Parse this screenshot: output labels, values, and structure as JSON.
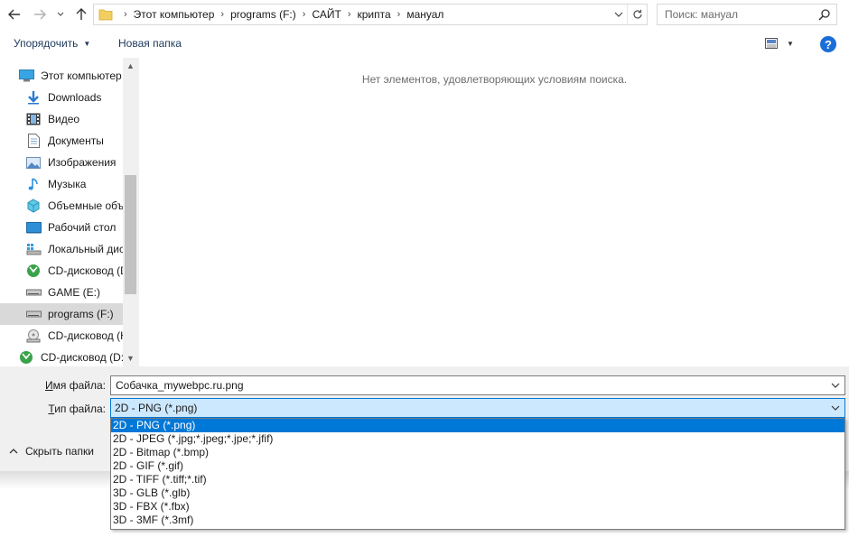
{
  "address_bar": {
    "breadcrumbs": [
      "Этот компьютер",
      "programs (F:)",
      "САЙТ",
      "крипта",
      "мануал"
    ],
    "search_placeholder": "Поиск: мануал"
  },
  "toolbar": {
    "organize_label": "Упорядочить",
    "new_folder_label": "Новая папка",
    "help_label": "?"
  },
  "nav_pane": {
    "items": [
      {
        "label": "Этот компьютер",
        "icon": "computer-icon",
        "indent": 0
      },
      {
        "label": "Downloads",
        "icon": "downloads-icon",
        "indent": 1
      },
      {
        "label": "Видео",
        "icon": "video-icon",
        "indent": 1
      },
      {
        "label": "Документы",
        "icon": "documents-icon",
        "indent": 1
      },
      {
        "label": "Изображения",
        "icon": "pictures-icon",
        "indent": 1
      },
      {
        "label": "Музыка",
        "icon": "music-icon",
        "indent": 1
      },
      {
        "label": "Объемные объ",
        "icon": "3d-objects-icon",
        "indent": 1
      },
      {
        "label": "Рабочий стол",
        "icon": "desktop-icon",
        "indent": 1
      },
      {
        "label": "Локальный дис",
        "icon": "local-disk-icon",
        "indent": 1
      },
      {
        "label": "CD-дисковод (D",
        "icon": "cd-drive-icon",
        "indent": 1
      },
      {
        "label": "GAME (E:)",
        "icon": "drive-icon",
        "indent": 1
      },
      {
        "label": "programs (F:)",
        "icon": "drive-icon",
        "indent": 1,
        "selected": true
      },
      {
        "label": "CD-дисковод (H",
        "icon": "cd-drive-icon",
        "indent": 1
      },
      {
        "label": "CD-дисковод (D:)",
        "icon": "cd-drive-icon",
        "indent": 0
      }
    ]
  },
  "content": {
    "empty_message": "Нет элементов, удовлетворяющих условиям поиска."
  },
  "bottom": {
    "filename_label": "Имя файла:",
    "filename_accel": "И",
    "filename_rest": "мя файла:",
    "filename_value": "Собачка_mywebpc.ru.png",
    "filetype_label": "Тип файла:",
    "filetype_accel": "Т",
    "filetype_rest": "ип файла:",
    "filetype_value": "2D - PNG (*.png)",
    "hide_folders_label": "Скрыть папки"
  },
  "dropdown": {
    "selected_index": 0,
    "options": [
      "2D - PNG (*.png)",
      "2D - JPEG (*.jpg;*.jpeg;*.jpe;*.jfif)",
      "2D - Bitmap (*.bmp)",
      "2D - GIF (*.gif)",
      "2D - TIFF (*.tiff;*.tif)",
      "3D - GLB (*.glb)",
      "3D - FBX (*.fbx)",
      "3D - 3MF (*.3mf)"
    ]
  },
  "colors": {
    "accent": "#0078d7",
    "selection_bg": "#cce8ff",
    "nav_selected": "#d9d9d9",
    "panel_bg": "#f0f0f0"
  }
}
